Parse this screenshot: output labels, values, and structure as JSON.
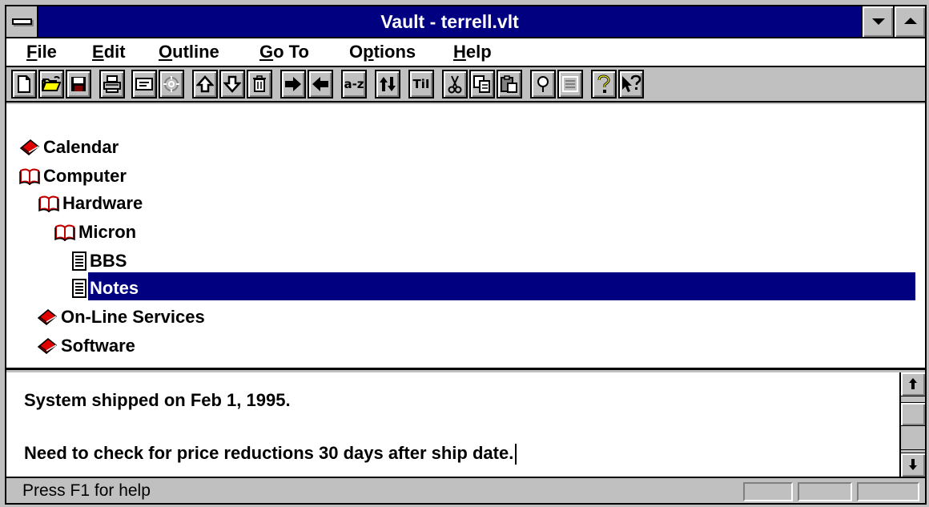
{
  "window": {
    "title": "Vault - terrell.vlt"
  },
  "menu": [
    {
      "mnemonic": "F",
      "rest": "ile"
    },
    {
      "mnemonic": "E",
      "rest": "dit"
    },
    {
      "mnemonic": "O",
      "rest": "utline"
    },
    {
      "mnemonic": "G",
      "rest": "o To"
    },
    {
      "pre": "O",
      "mnemonic": "p",
      "rest": "tions"
    },
    {
      "mnemonic": "H",
      "rest": "elp"
    }
  ],
  "toolbar": {
    "sort_label": "a-z",
    "title_label": "TiI",
    "icons": [
      "new-file-icon",
      "open-folder-icon",
      "save-disk-icon",
      "print-icon",
      "note-card-icon",
      "disabled-gear-icon",
      "move-up-icon",
      "move-down-icon",
      "delete-trash-icon",
      "indent-right-icon",
      "outdent-left-icon",
      "sort-az-icon",
      "swap-updown-icon",
      "title-case-icon",
      "cut-scissors-icon",
      "copy-icon",
      "paste-icon",
      "search-bulb-icon",
      "list-lines-icon",
      "help-question-icon",
      "context-help-icon"
    ]
  },
  "outline": {
    "items": [
      {
        "label": "Calendar",
        "type": "closed-book"
      },
      {
        "label": "Computer",
        "type": "open-book"
      },
      {
        "label": "Hardware",
        "type": "open-book"
      },
      {
        "label": "Micron",
        "type": "open-book"
      },
      {
        "label": "BBS",
        "type": "page"
      },
      {
        "label": "Notes",
        "type": "page",
        "selected": true
      },
      {
        "label": "On-Line Services",
        "type": "closed-book"
      },
      {
        "label": "Software",
        "type": "closed-book"
      }
    ]
  },
  "note": {
    "line1": "System shipped on Feb 1, 1995.",
    "line2": "Need to check for price reductions 30 days after ship date."
  },
  "status": {
    "text": "Press F1 for help"
  },
  "colors": {
    "titlebar": "#000080",
    "selection": "#000080",
    "face": "#c0c0c0",
    "book_red": "#d00000"
  }
}
